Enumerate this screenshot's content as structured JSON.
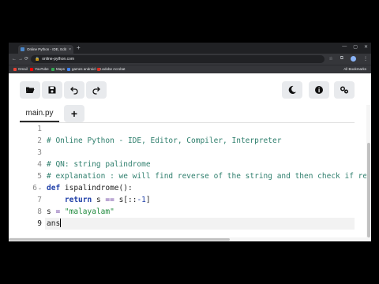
{
  "browser": {
    "tab_title": "Online Python - IDE, Editor, C...",
    "tab_close": "×",
    "new_tab": "+",
    "url": "online-python.com",
    "lock_icon": "🔒",
    "back_icon": "←",
    "forward_icon": "→",
    "reload_icon": "⟳",
    "star_icon": "☆",
    "extensions_icon": "⧉",
    "menu_icon": "⋮",
    "window_controls": [
      "—",
      "▢",
      "✕"
    ],
    "bookmarks": [
      {
        "label": "Gmail",
        "color": "#ea4335"
      },
      {
        "label": "YouTube",
        "color": "#ff0000"
      },
      {
        "label": "Maps",
        "color": "#34a853"
      },
      {
        "label": "games android - G...",
        "color": "#4285f4"
      },
      {
        "label": "Adobe Acrobat",
        "color": "#d93025"
      }
    ],
    "all_bookmarks": "All Bookmarks"
  },
  "ide": {
    "toolbar": {
      "open_icon": "folder-open-icon",
      "save_icon": "save-icon",
      "undo_icon": "undo-icon",
      "redo_icon": "redo-icon",
      "theme_icon": "moon-icon",
      "info_icon": "info-icon",
      "settings_icon": "gear-icon"
    },
    "file_tab": "main.py",
    "add_tab": "+",
    "line_numbers": [
      "1",
      "2",
      "3",
      "4",
      "5",
      "6",
      "7",
      "8",
      "9"
    ],
    "active_line": 9,
    "fold_markers": {
      "6": "⌄"
    },
    "code": {
      "l1": "",
      "l2": "# Online Python - IDE, Editor, Compiler, Interpreter",
      "l3": "",
      "l4": "# QN: string palindrome",
      "l5": "# explanation : we will find reverse of the string and then check if re",
      "l6_kw": "def",
      "l6_rest": " ispalindrome():",
      "l7_indent": "    ",
      "l7_kw": "return",
      "l7_rest_a": " s ",
      "l7_op": "==",
      "l7_rest_b": " s[::",
      "l7_num": "-1",
      "l7_rest_c": "]",
      "l8_a": "s ",
      "l8_op": "=",
      "l8_sp": " ",
      "l8_str": "\"malayalam\"",
      "l9": "ans"
    },
    "colors": {
      "comment": "#2f7f6d",
      "keyword": "#1f3fa8",
      "string": "#1e8a3c",
      "operator": "#6b3fa0"
    }
  }
}
